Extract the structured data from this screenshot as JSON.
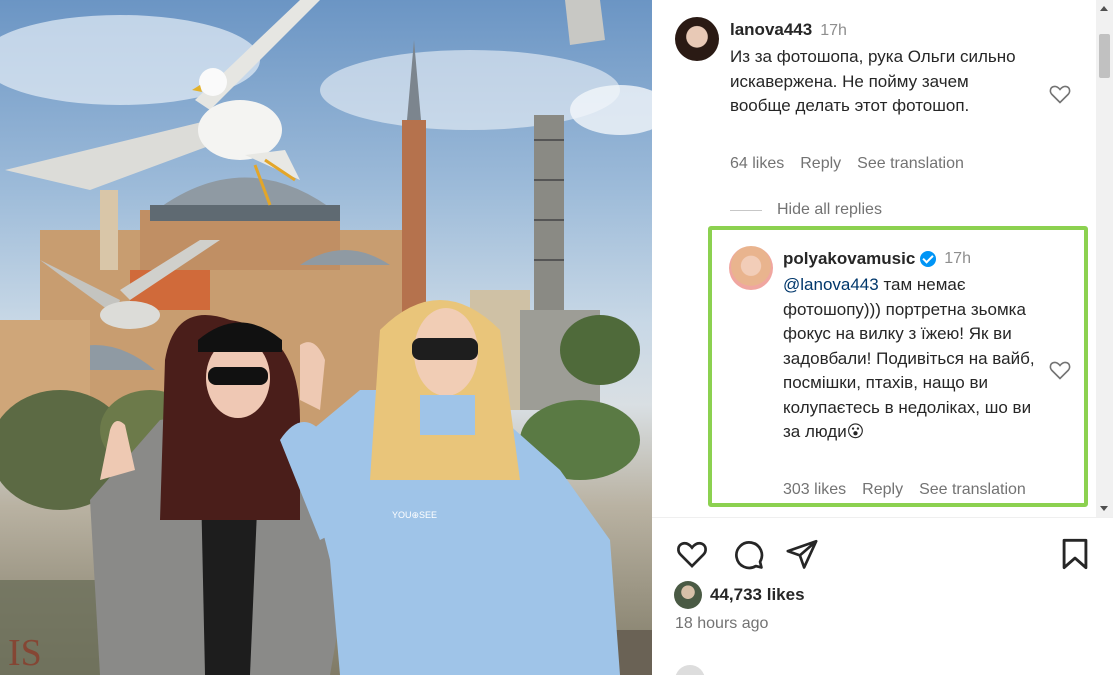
{
  "photo": {
    "description_icon": "post-photo",
    "watermark_left": "YOU",
    "watermark_center": "YOU⊕SEE"
  },
  "comments": [
    {
      "username": "lanova443",
      "time": "17h",
      "text": "Из за фотошопа, рука Ольги сильно искаверженa. Не пойму зачем вообще делать этот фотошоп.",
      "likes": "64 likes",
      "reply": "Reply",
      "translate": "See translation"
    }
  ],
  "hide_replies": "Hide all replies",
  "reply": {
    "username": "polyakovamusic",
    "time": "17h",
    "mention": "@lanova443",
    "text": " там немає фотошопу))) портретна зьомка фокус на вилку з їжею! Як ви задовбали! Подивіться на вайб, посмішки, птахів, нащо ви колупаєтесь в недоліках, шо ви за люди😮",
    "likes": "303 likes",
    "reply": "Reply",
    "translate": "See translation",
    "highlight_color": "#8cd150"
  },
  "post": {
    "likes": "44,733 likes",
    "time": "18 hours ago"
  },
  "icons": {
    "like": "heart-icon",
    "comment": "comment-icon",
    "share": "share-icon",
    "save": "bookmark-icon"
  }
}
